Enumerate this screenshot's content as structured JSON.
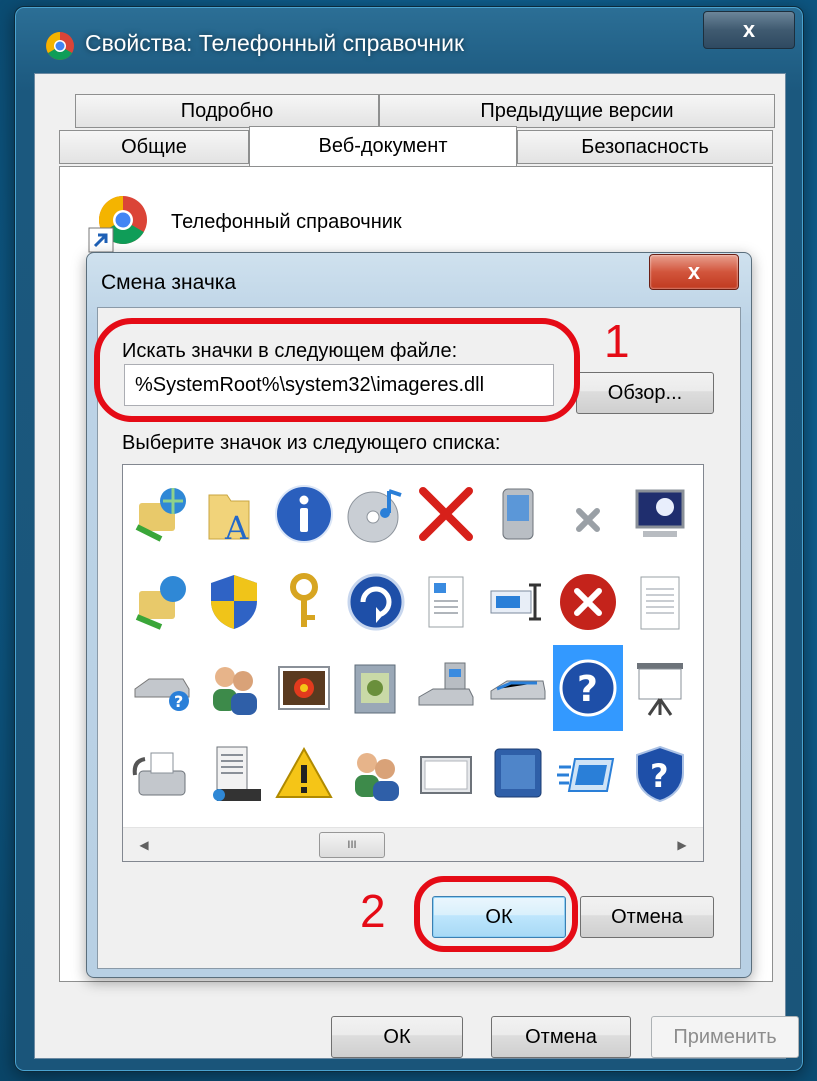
{
  "window": {
    "title": "Свойства: Телефонный справочник",
    "close_label": "x"
  },
  "tabs": {
    "row1": [
      "Подробно",
      "Предыдущие версии"
    ],
    "row2": [
      "Общие",
      "Веб-документ",
      "Безопасность"
    ],
    "active": "Веб-документ"
  },
  "document": {
    "name": "Телефонный справочник"
  },
  "dialog": {
    "title": "Смена значка",
    "close_label": "x",
    "file_label": "Искать значки в следующем файле:",
    "file_value": "%SystemRoot%\\system32\\imageres.dll",
    "browse_label": "Обзор...",
    "list_label": "Выберите значок из следующего списка:",
    "scroll_thumb": "III",
    "ok_label": "ОК",
    "cancel_label": "Отмена"
  },
  "annotations": {
    "first": "1",
    "second": "2"
  },
  "footer": {
    "ok_label": "ОК",
    "cancel_label": "Отмена",
    "apply_label": "Применить"
  },
  "icons": [
    [
      "network-share-icon",
      "folder-font-icon",
      "info-icon",
      "cd-music-icon",
      "red-x-icon",
      "pda-icon",
      "small-x-icon",
      "monitor-icon"
    ],
    [
      "network-folder-icon",
      "shield-icon",
      "key-icon",
      "reload-arrow-icon",
      "document-image-icon",
      "text-cursor-icon",
      "error-icon",
      "blank-document-icon"
    ],
    [
      "drive-question-icon",
      "users-icon",
      "flower-picture-icon",
      "media-box-icon",
      "server-drive-icon",
      "scanner-icon",
      "help-question-icon",
      "projector-screen-icon"
    ],
    [
      "fax-icon",
      "server-tower-icon",
      "warning-icon",
      "users-group-icon",
      "window-frame-icon",
      "tablet-icon",
      "fast-window-icon",
      "shield-question-icon"
    ]
  ],
  "selected_icon": "help-question-icon",
  "colors": {
    "annotation": "#e50b16",
    "selection": "#3399ff",
    "desktop": "#0f5f8f"
  }
}
